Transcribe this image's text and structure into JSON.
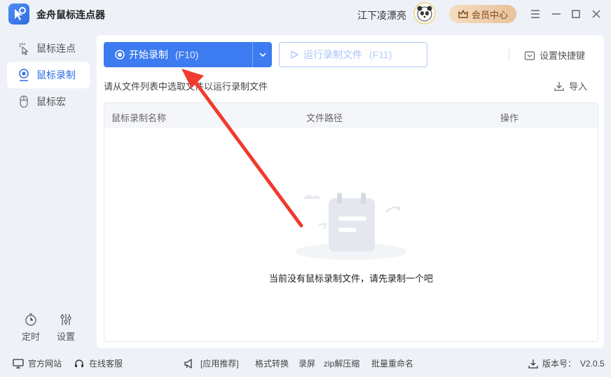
{
  "app": {
    "title": "金舟鼠标连点器",
    "username": "江下凌漂亮",
    "vip_label": "会员中心"
  },
  "sidebar": {
    "items": [
      {
        "label": "鼠标连点",
        "icon": "click-cursor-icon",
        "active": false
      },
      {
        "label": "鼠标录制",
        "icon": "record-user-icon",
        "active": true
      },
      {
        "label": "鼠标宏",
        "icon": "mouse-icon",
        "active": false
      }
    ],
    "bottom": [
      {
        "label": "定时",
        "icon": "timer-icon"
      },
      {
        "label": "设置",
        "icon": "sliders-icon"
      }
    ]
  },
  "toolbar": {
    "start_label": "开始录制",
    "start_hotkey": "(F10)",
    "run_label": "运行录制文件",
    "run_hotkey": "(F11)",
    "shortcut_label": "设置快捷键"
  },
  "main": {
    "hint": "请从文件列表中选取文件以运行录制文件",
    "import_label": "导入",
    "columns": [
      "鼠标录制名称",
      "文件路径",
      "操作"
    ],
    "rows": [],
    "empty_text": "当前没有鼠标录制文件，请先录制一个吧"
  },
  "footer": {
    "website": "官方网站",
    "support": "在线客服",
    "recommend": "[应用推荐]",
    "links": [
      "格式转换",
      "录屏",
      "zip解压缩",
      "批量重命名"
    ],
    "version_label": "版本号：",
    "version": "V2.0.5"
  },
  "colors": {
    "accent": "#3d7bf0",
    "background": "#eef2f8",
    "annotation_arrow": "#f03a2e"
  }
}
